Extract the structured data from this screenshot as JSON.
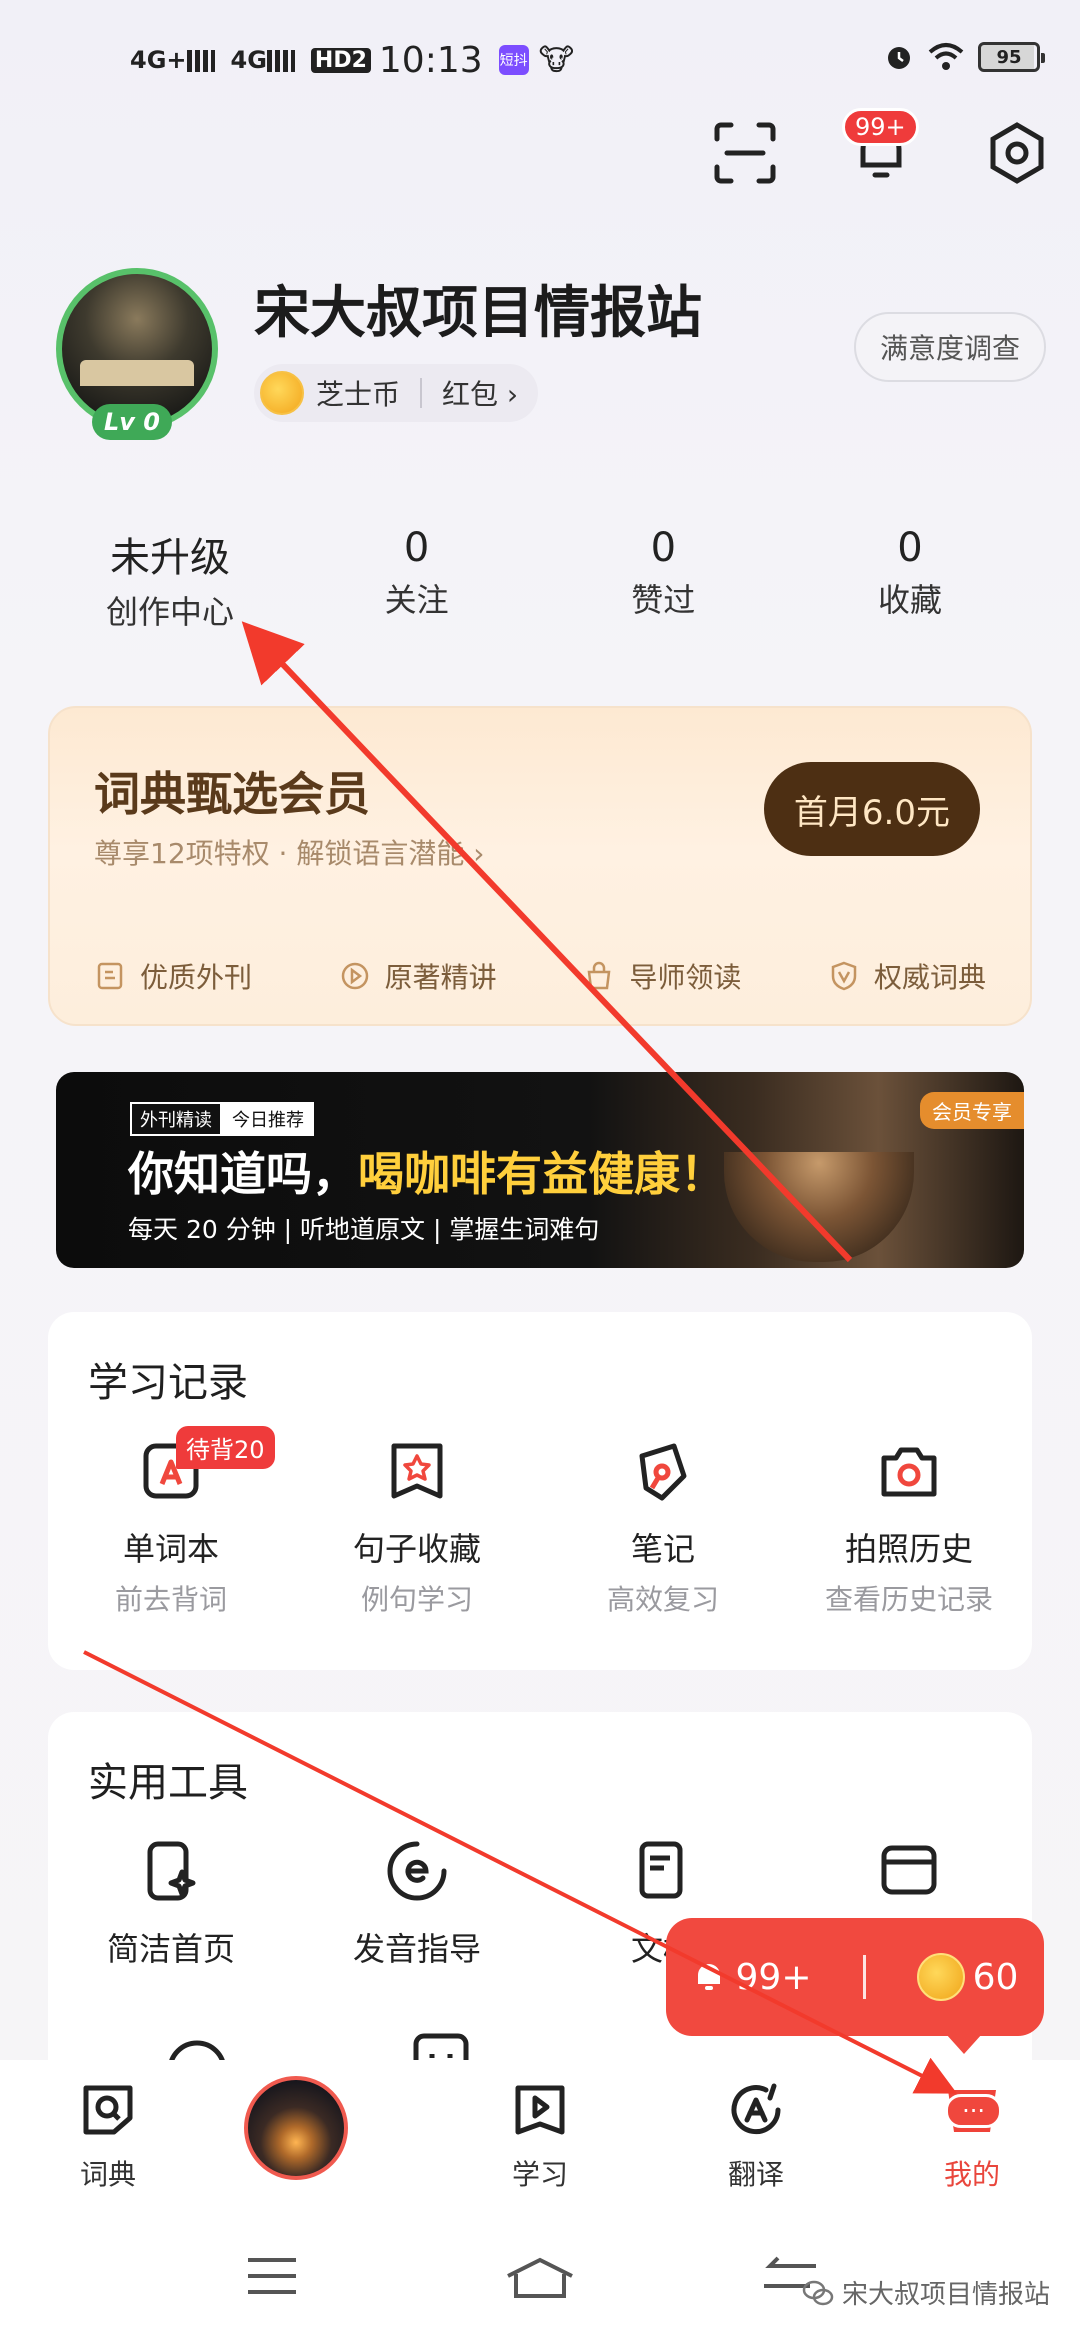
{
  "status_bar": {
    "signal1": "4G+",
    "signal2": "4G",
    "hd": "HD2",
    "time": "10:13",
    "app_icon": "短抖",
    "battery": "95"
  },
  "header": {
    "scan_icon": "scan-icon",
    "message_badge": "99+",
    "settings_icon": "settings-icon"
  },
  "profile": {
    "nickname": "宋大叔项目情报站",
    "level": "Lv 0",
    "coin_label": "芝士币",
    "red_packet_label": "红包 ›",
    "survey_label": "满意度调查"
  },
  "stats": [
    {
      "value": "未升级",
      "label": "创作中心"
    },
    {
      "value": "0",
      "label": "关注"
    },
    {
      "value": "0",
      "label": "赞过"
    },
    {
      "value": "0",
      "label": "收藏"
    }
  ],
  "vip": {
    "title": "词典甄选会员",
    "subtitle": "尊享12项特权 · 解锁语言潜能 ›",
    "button": "首月6.0元",
    "features": [
      "优质外刊",
      "原著精讲",
      "导师领读",
      "权威词典"
    ]
  },
  "banner": {
    "tag1": "外刊精读",
    "tag2": "今日推荐",
    "headline_part1": "你知道吗，",
    "headline_part2": "喝咖啡有益健康！",
    "subline": "每天 20 分钟 | 听地道原文 | 掌握生词难句",
    "vip_tag": "会员专享"
  },
  "study": {
    "title": "学习记录",
    "badge": "待背20",
    "items": [
      {
        "title": "单词本",
        "subtitle": "前去背词"
      },
      {
        "title": "句子收藏",
        "subtitle": "例句学习"
      },
      {
        "title": "笔记",
        "subtitle": "高效复习"
      },
      {
        "title": "拍照历史",
        "subtitle": "查看历史记录"
      }
    ]
  },
  "tools": {
    "title": "实用工具",
    "items": [
      {
        "title": "简洁首页"
      },
      {
        "title": "发音指导"
      },
      {
        "title": "文档"
      },
      {
        "title": ""
      }
    ]
  },
  "floating": {
    "messages": "99+",
    "coins": "60"
  },
  "bottom_nav": {
    "items": [
      "词典",
      "",
      "学习",
      "翻译",
      "我的"
    ],
    "dots": "···"
  },
  "watermark": "宋大叔项目情报站",
  "colors": {
    "accent_red": "#e9463c",
    "vip_brown": "#4d2f13",
    "level_green": "#3fa957"
  }
}
